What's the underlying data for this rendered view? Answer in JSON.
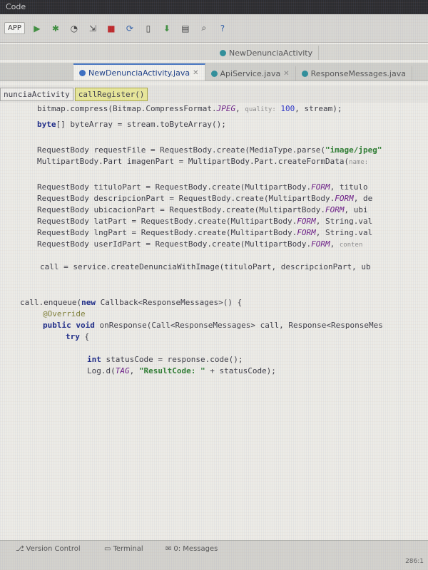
{
  "titlebar": {
    "text": "Code"
  },
  "toolbar": {
    "run_config": "APP",
    "buttons": [
      {
        "icon": "play-icon"
      },
      {
        "icon": "debug-icon"
      },
      {
        "icon": "profile-icon"
      },
      {
        "icon": "attach-icon"
      },
      {
        "icon": "stop-icon"
      },
      {
        "icon": "sync-icon"
      },
      {
        "icon": "avd-manager-icon"
      },
      {
        "icon": "sdk-manager-icon"
      },
      {
        "icon": "structure-icon"
      },
      {
        "icon": "search-icon"
      },
      {
        "icon": "help-icon"
      }
    ]
  },
  "tabs_top": [
    {
      "label": "NewDenunciaActivity"
    }
  ],
  "tabs_files": [
    {
      "label": "NewDenunciaActivity.java",
      "active": true
    },
    {
      "label": "ApiService.java",
      "active": false
    },
    {
      "label": "ResponseMessages.java",
      "active": false
    }
  ],
  "breadcrumb": {
    "class_name": "nunciaActivity",
    "method_name": "callRegister()"
  },
  "code": {
    "line1": {
      "a": "bitmap.compress(Bitmap.CompressFormat.",
      "b": "JPEG",
      "c": ", ",
      "hint": "quality:",
      "d": " ",
      "num": "100",
      "e": ", stream);"
    },
    "line2": {
      "kw": "byte",
      "rest": "[] byteArray = stream.toByteArray();"
    },
    "line3": {
      "a": "RequestBody requestFile = RequestBody.create(MediaType.parse(",
      "str": "\"image/jpeg\""
    },
    "line4": {
      "a": "MultipartBody.Part imagenPart = MultipartBody.Part.createFormData(",
      "hint": "name:"
    },
    "line5": {
      "a": "RequestBody tituloPart = RequestBody.create(MultipartBody.",
      "fld": "FORM",
      "b": ", titulo"
    },
    "line6": {
      "a": "RequestBody descripcionPart = RequestBody.create(MultipartBody.",
      "fld": "FORM",
      "b": ", de"
    },
    "line7": {
      "a": "RequestBody ubicacionPart = RequestBody.create(MultipartBody.",
      "fld": "FORM",
      "b": ", ubi"
    },
    "line8": {
      "a": "RequestBody latPart = RequestBody.create(MultipartBody.",
      "fld": "FORM",
      "b": ", String.val"
    },
    "line9": {
      "a": "RequestBody lngPart = RequestBody.create(MultipartBody.",
      "fld": "FORM",
      "b": ", String.val"
    },
    "line10": {
      "a": "RequestBody userIdPart = RequestBody.create(MultipartBody.",
      "fld": "FORM",
      "b": ", ",
      "hint": "conten"
    },
    "line11": {
      "a": "call = service.createDenunciaWithImage(tituloPart, descripcionPart, ub"
    },
    "line12": {
      "a": "call.enqueue(",
      "kw": "new",
      "b": " Callback<ResponseMessages>() {"
    },
    "line13": {
      "ann": "@Override"
    },
    "line14": {
      "kw": "public void",
      "a": " onResponse(Call<ResponseMessages> call, Response<ResponseMes"
    },
    "line15": {
      "kw": "try",
      "a": " {"
    },
    "line16": {
      "kw": "int",
      "a": " statusCode = response.code();"
    },
    "line17": {
      "a": "Log.d(",
      "fld": "TAG",
      "b": ", ",
      "str": "\"ResultCode: \"",
      "c": " + statusCode);"
    }
  },
  "statusbar": {
    "version_control": "Version Control",
    "terminal": "Terminal",
    "messages": "0: Messages",
    "position": "286:1"
  }
}
